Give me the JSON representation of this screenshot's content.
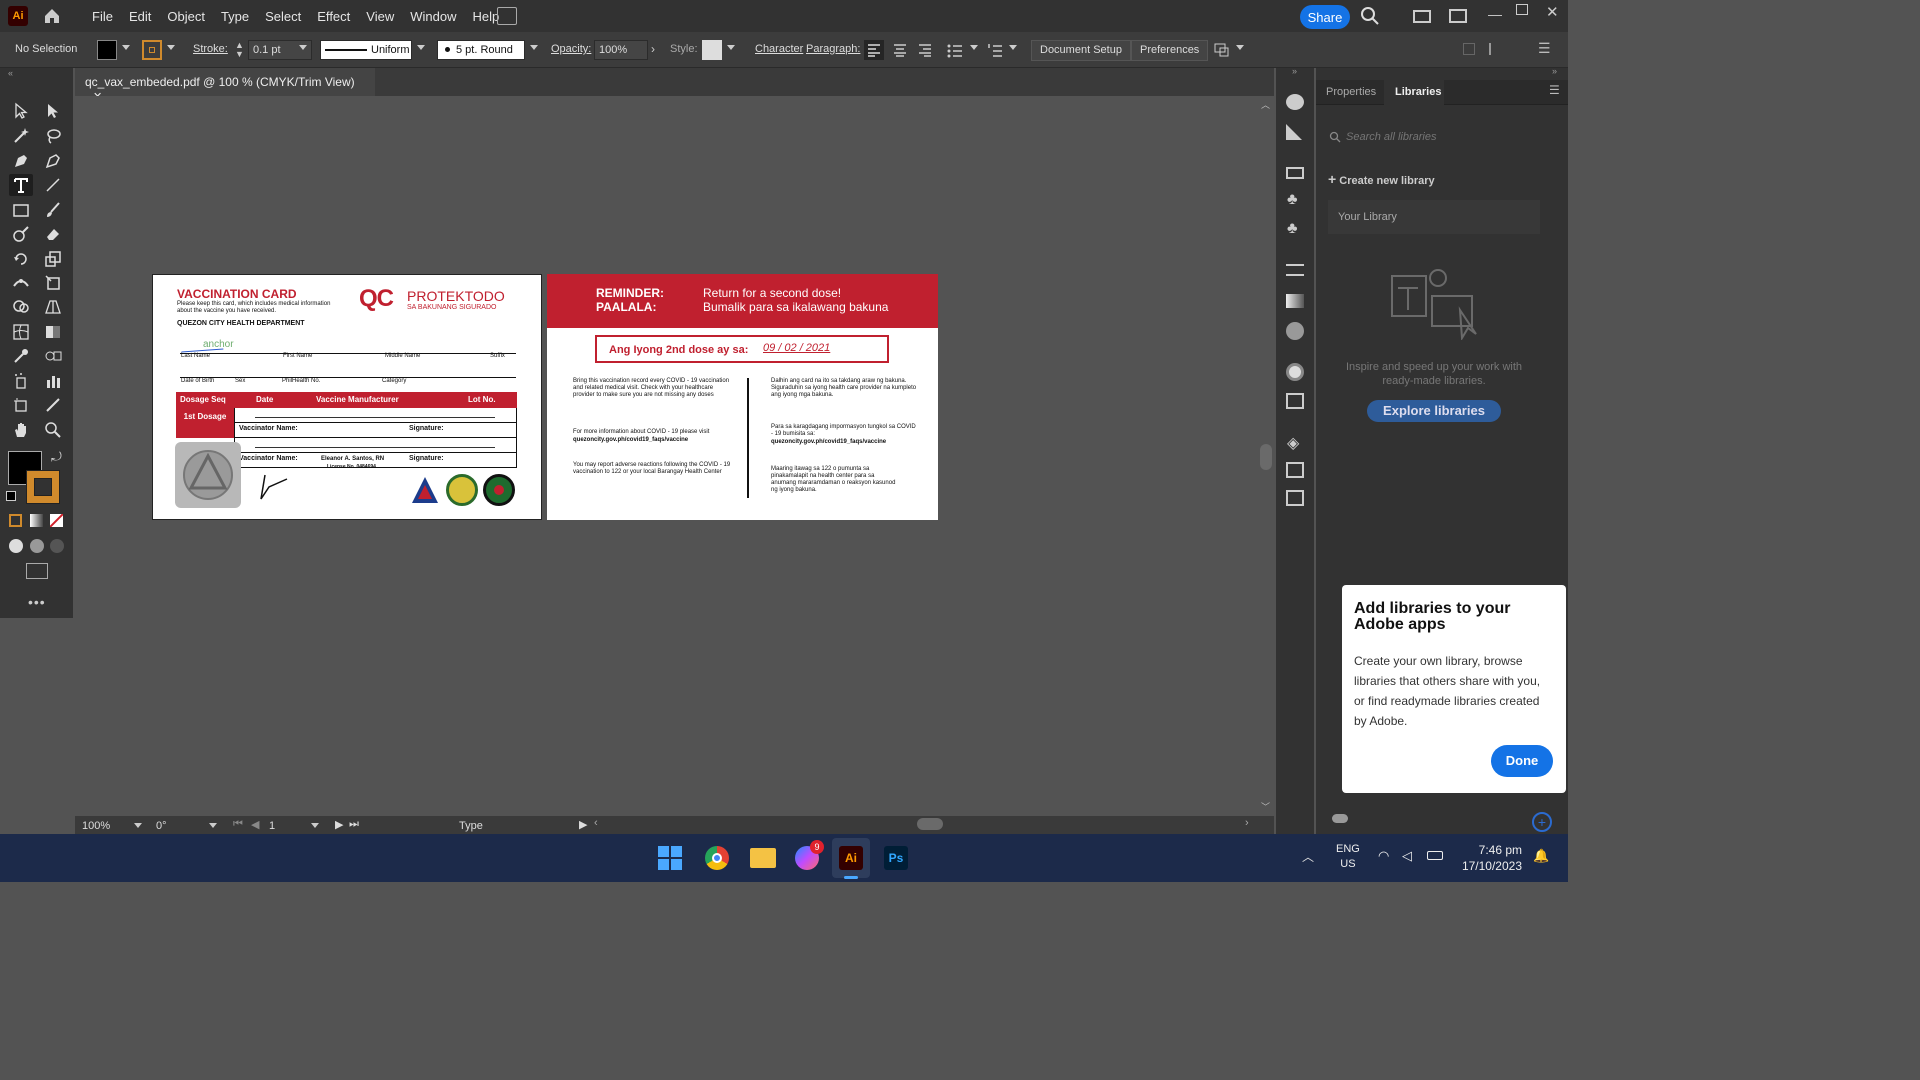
{
  "app": {
    "logo": "Ai"
  },
  "menu": [
    "File",
    "Edit",
    "Object",
    "Type",
    "Select",
    "Effect",
    "View",
    "Window",
    "Help"
  ],
  "share_label": "Share",
  "control": {
    "selection": "No Selection",
    "stroke_label": "Stroke:",
    "stroke_value": "0.1 pt",
    "profile": "Uniform",
    "brush": "5 pt. Round",
    "opacity_label": "Opacity:",
    "opacity_value": "100%",
    "style_label": "Style:",
    "character": "Character",
    "paragraph": "Paragraph:",
    "document_setup": "Document Setup",
    "preferences": "Preferences"
  },
  "document_tab": {
    "title": "qc_vax_embeded.pdf @ 100 % (CMYK/Trim View)",
    "close": "✕"
  },
  "status": {
    "zoom": "100%",
    "rotation": "0°",
    "page": "1",
    "tool": "Type"
  },
  "panel": {
    "tabs": [
      "Properties",
      "Libraries"
    ],
    "search_placeholder": "Search all libraries",
    "create_new": "Create new library",
    "your_library": "Your Library",
    "inspire_text": "Inspire and speed up your work with ready-made libraries.",
    "explore_button": "Explore libraries"
  },
  "popup": {
    "title": "Add libraries to your Adobe apps",
    "body": "Create your own library, browse libraries that others share with you, or find readymade libraries created by Adobe.",
    "done": "Done"
  },
  "card_front": {
    "title": "VACCINATION CARD",
    "subtitle": "Please keep this card, which includes medical information about the vaccine you have received.",
    "dept": "QUEZON CITY HEALTH DEPARTMENT",
    "brand_qc": "QC",
    "brand_name": "PROTEKTODO",
    "brand_tag": "SA BAKUNANG SIGURADO",
    "anchor_word": "anchor",
    "name_labels": [
      "Last Name",
      "First Name",
      "Middle Name",
      "Suffix"
    ],
    "info_labels": [
      "Date of Birth",
      "Sex",
      "PhilHealth No.",
      "Category"
    ],
    "table_headers": [
      "Dosage Seq",
      "Date",
      "Vaccine Manufacturer",
      "Lot No."
    ],
    "dose_label": "1st Dosage",
    "vaccinator_label": "Vaccinator Name:",
    "signature_label": "Signature:",
    "vaccinator_name": "Eleanor A. Santos, RN",
    "license": "License No. 0484694"
  },
  "card_back": {
    "reminder_label": "REMINDER:",
    "paalala_label": "PAALALA:",
    "reminder_text": "Return for a second dose!",
    "paalala_text": "Bumalik para sa ikalawang bakuna",
    "second_dose_label": "Ang Iyong 2nd dose ay sa:",
    "second_dose_date": "09 / 02 / 2021",
    "left_p1": "Bring this vaccination record every COVID - 19 vaccination and related medical visit. Check with your healthcare provider to make sure you are not missing any doses",
    "left_p2": "For more information about COVID - 19 please visit",
    "left_link": "quezoncity.gov.ph/covid19_faqs/vaccine",
    "left_p3": "You may report adverse reactions following the COVID - 19 vaccination to 122 or your local Barangay Health Center",
    "right_p1": "Dalhin ang card na ito sa takdang araw ng bakuna. Siguraduhin sa iyong health care provider na kumpleto ang iyong mga bakuna.",
    "right_p2": "Para sa karagdagang impormasyon tungkol sa COVID - 19 bumisita sa:",
    "right_link": "quezoncity.gov.ph/covid19_faqs/vaccine",
    "right_p3": "Maaring itawag sa 122 o pumunta sa pinakamalapit na health center para sa anumang mararamdaman o reaksyon kasunod ng iyong bakuna."
  },
  "taskbar": {
    "lang": "ENG",
    "region": "US",
    "time": "7:46 pm",
    "date": "17/10/2023",
    "messenger_badge": "9",
    "ai_label": "Ai",
    "ps_label": "Ps"
  }
}
